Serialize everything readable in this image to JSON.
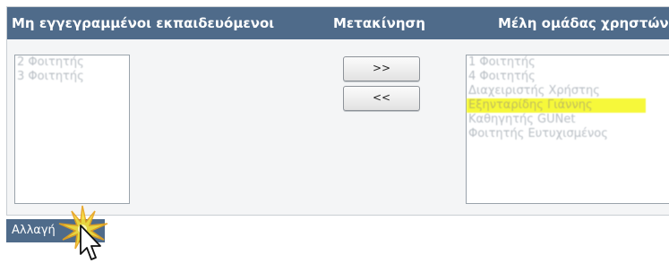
{
  "header": {
    "left_title": "Μη εγγεγραμμένοι εκπαιδευόμενοι",
    "middle_title": "Μετακίνηση",
    "right_title": "Μέλη ομάδας χρηστών"
  },
  "unregistered_list": {
    "items": [
      "2 Φοιτητής",
      "3 Φοιτητής"
    ]
  },
  "members_list": {
    "items": [
      "1 Φοιτητής",
      "4 Φοιτητής",
      "Διαχειριστής Χρήστης",
      "Εξηνταρίδης Γιάννης",
      "Καθηγητής GUNet",
      "Φοιτητής Ευτυχισμένος"
    ],
    "selected_index": 3
  },
  "buttons": {
    "add": ">>",
    "remove": "<<",
    "change": "Αλλαγή"
  }
}
